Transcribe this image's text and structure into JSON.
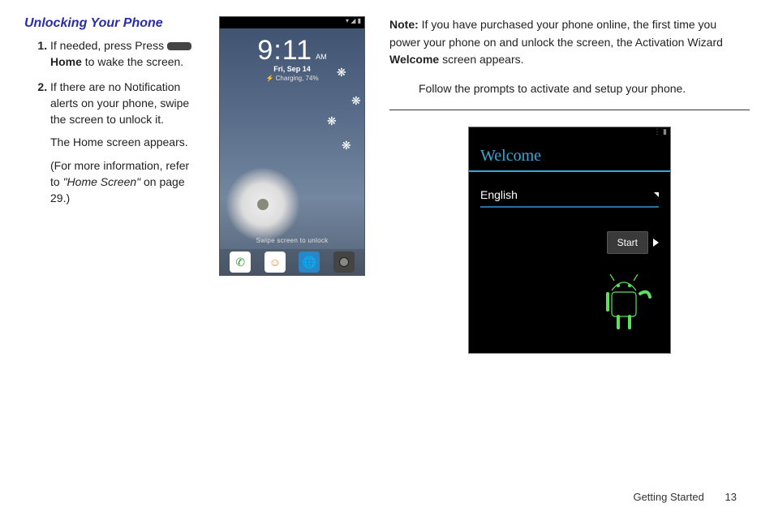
{
  "left": {
    "heading": "Unlocking Your Phone",
    "step1_pre": "If needed, press Press ",
    "step1_icon_label": "Home",
    "step1_post": " to wake the screen.",
    "step2_main": "If there are no Notification alerts on your phone, swipe the screen to unlock it.",
    "step2_sub1": "The Home screen appears.",
    "step2_sub2_pre": "(For more information, refer to ",
    "step2_sub2_ref": "\"Home Screen\"",
    "step2_sub2_post": " on page 29.)"
  },
  "lockscreen": {
    "time": "9:11",
    "ampm": "AM",
    "date": "Fri, Sep 14",
    "charging_icon": "⚡",
    "charging_text": "Charging, 74%",
    "hint": "Swipe screen to unlock",
    "dock": {
      "phone_icon": "phone-icon",
      "chat_icon": "chat-icon",
      "browser_icon": "browser-icon",
      "camera_icon": "camera-icon"
    }
  },
  "right": {
    "note_label": "Note:",
    "note_line1": "If you have purchased your phone online, the first time you power your phone on and unlock the screen, the Activation Wizard ",
    "note_bold": "Welcome",
    "note_line1_end": " screen appears.",
    "note_follow": "Follow the prompts to activate and setup your phone."
  },
  "welcome": {
    "title": "Welcome",
    "language": "English",
    "start": "Start"
  },
  "footer": {
    "section": "Getting Started",
    "page": "13"
  }
}
